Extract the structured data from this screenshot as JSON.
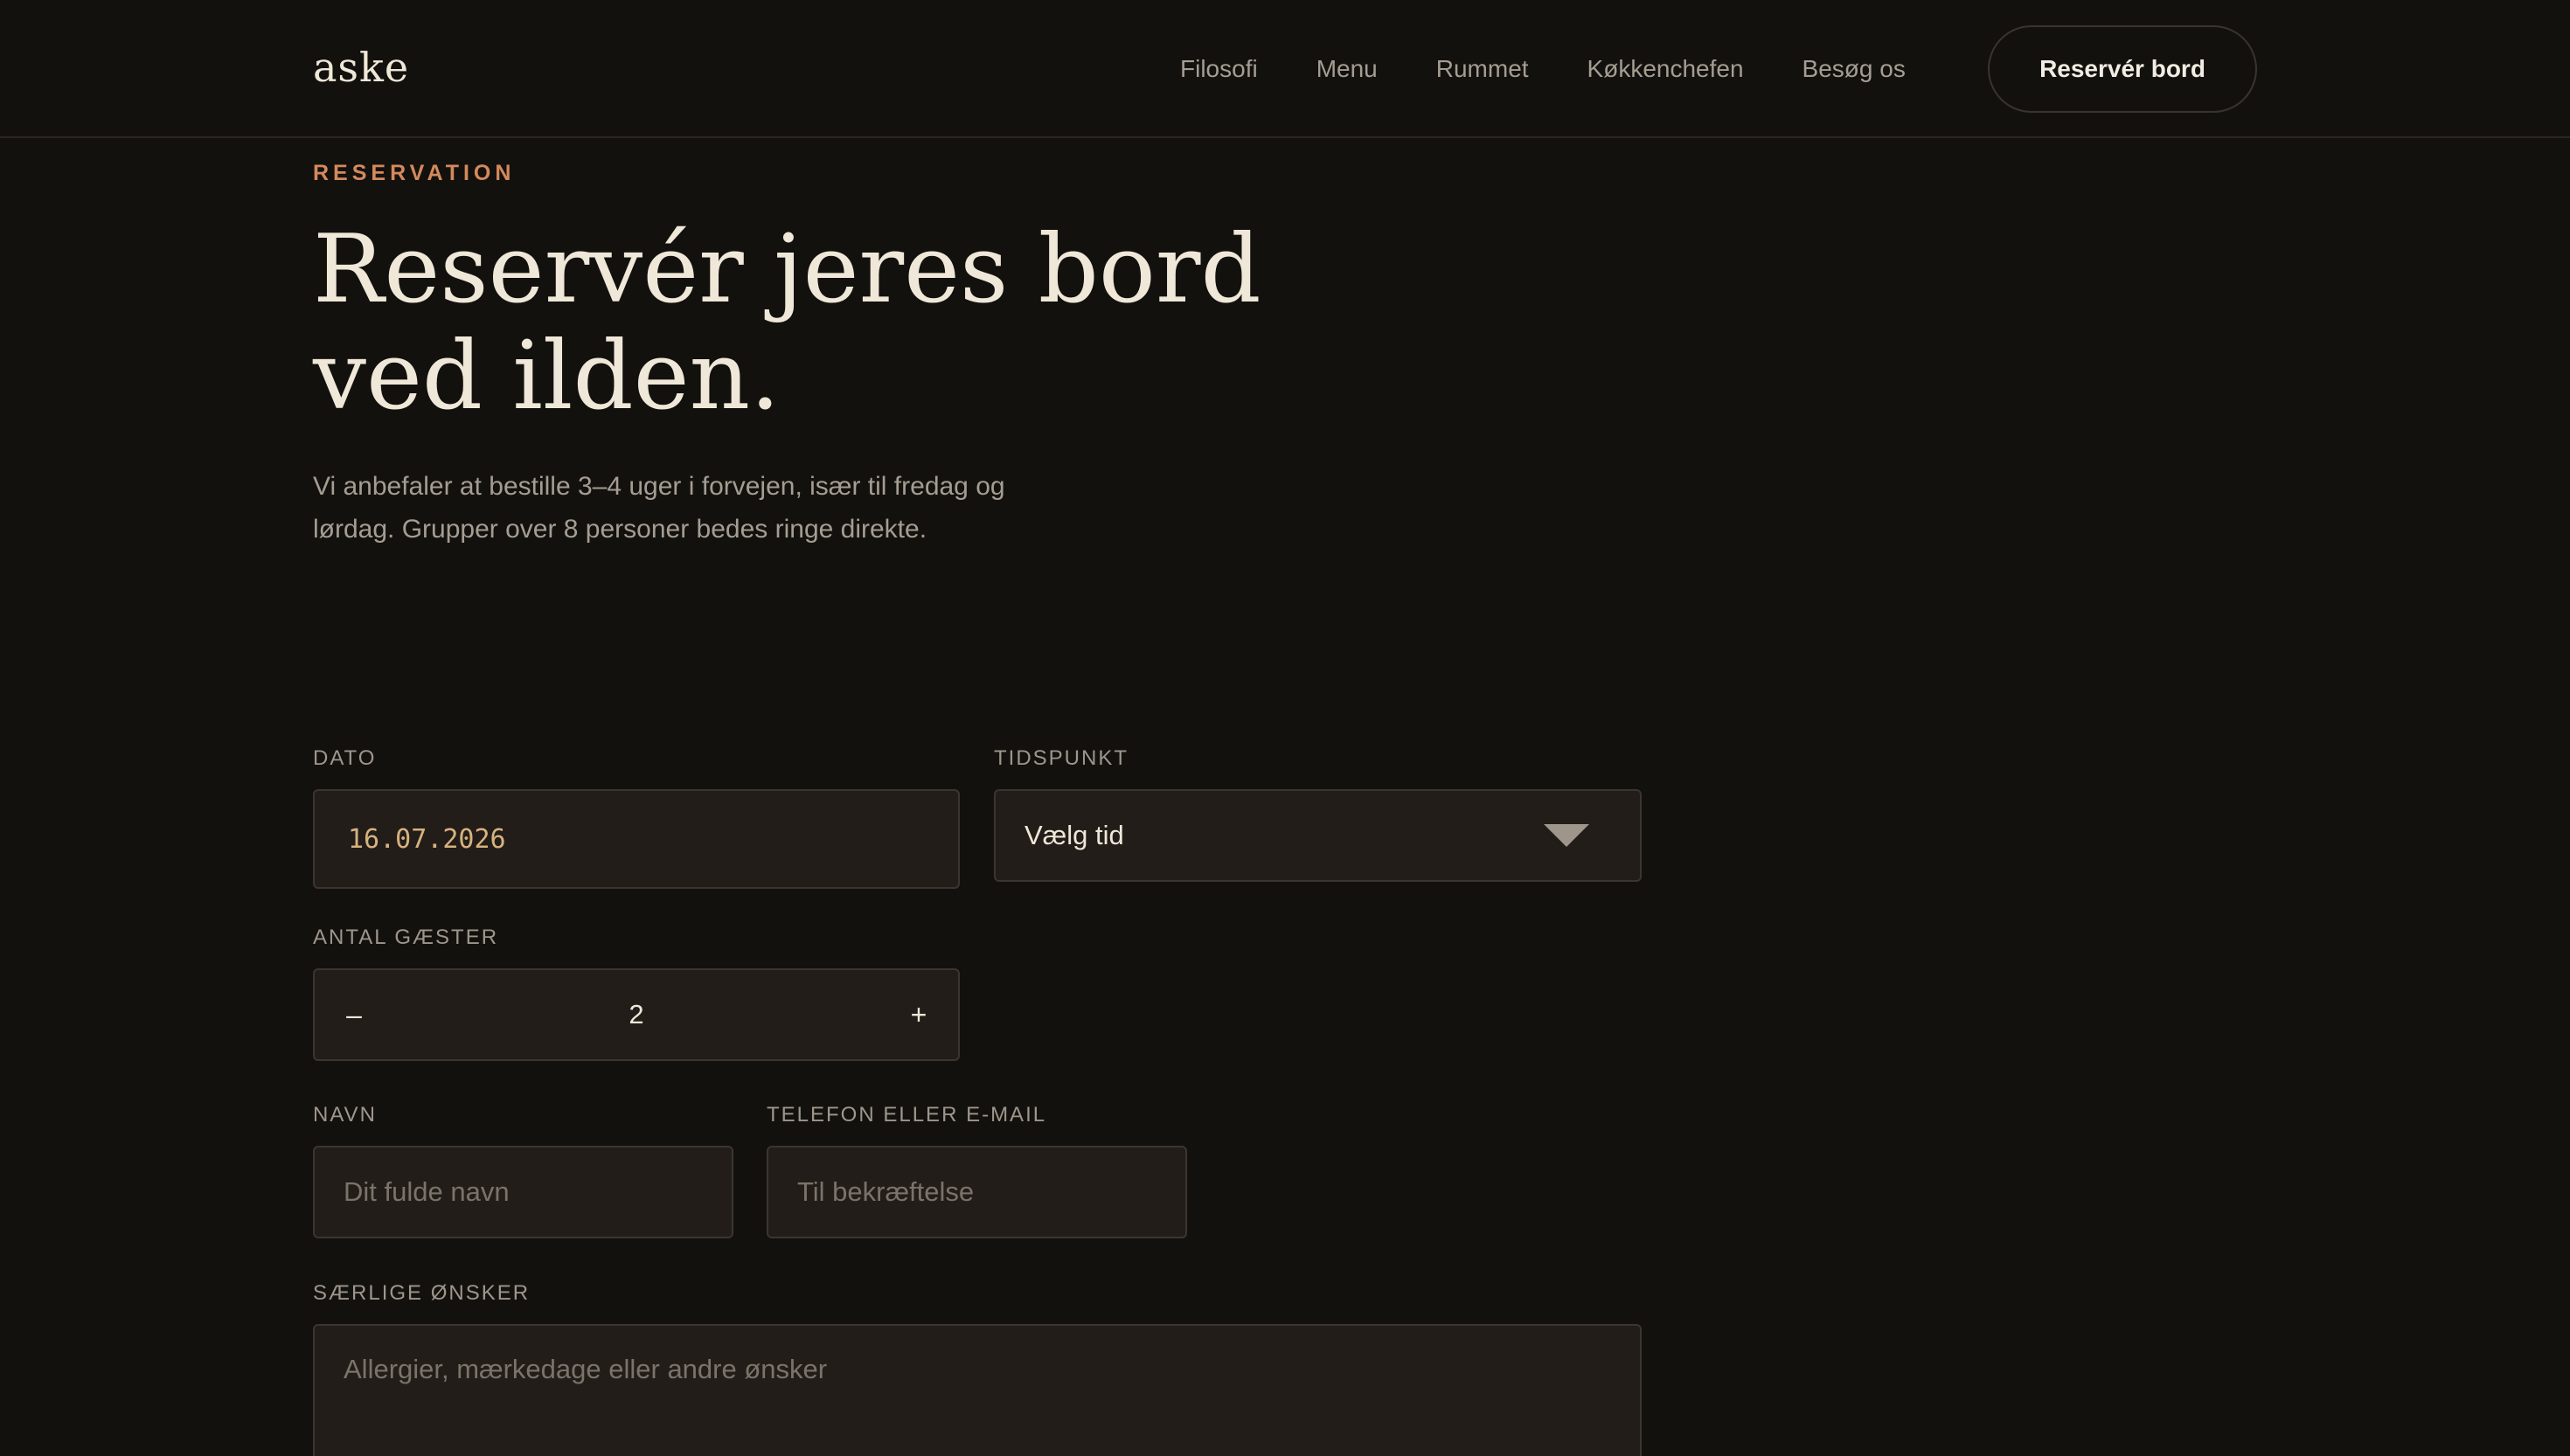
{
  "header": {
    "logo": "aske",
    "nav": [
      "Filosofi",
      "Menu",
      "Rummet",
      "Køkkenchefen",
      "Besøg os"
    ],
    "cta": "Reservér bord"
  },
  "hero": {
    "eyebrow": "RESERVATION",
    "title_line1": "Reservér jeres bord",
    "title_line2": "ved ilden.",
    "subtitle_line1": "Vi anbefaler at bestille 3–4 uger i forvejen, især til fredag og",
    "subtitle_line2": "lørdag. Grupper over 8 personer bedes ringe direkte."
  },
  "form": {
    "date": {
      "label": "DATO",
      "value": "16.07.2026"
    },
    "time": {
      "label": "TIDSPUNKT",
      "value": "Vælg tid"
    },
    "guests": {
      "label": "ANTAL GÆSTER",
      "value": "2",
      "minus": "–",
      "plus": "+"
    },
    "name": {
      "label": "NAVN",
      "placeholder": "Dit fulde navn"
    },
    "contact": {
      "label": "TELEFON ELLER E-MAIL",
      "placeholder": "Til bekræftelse"
    },
    "requests": {
      "label": "SÆRLIGE ØNSKER",
      "placeholder": "Allergier, mærkedage eller andre ønsker"
    }
  },
  "colors": {
    "background": "#13110e",
    "accent": "#d4895c",
    "date_text": "#d7b27e",
    "field_bg": "#221d19"
  }
}
